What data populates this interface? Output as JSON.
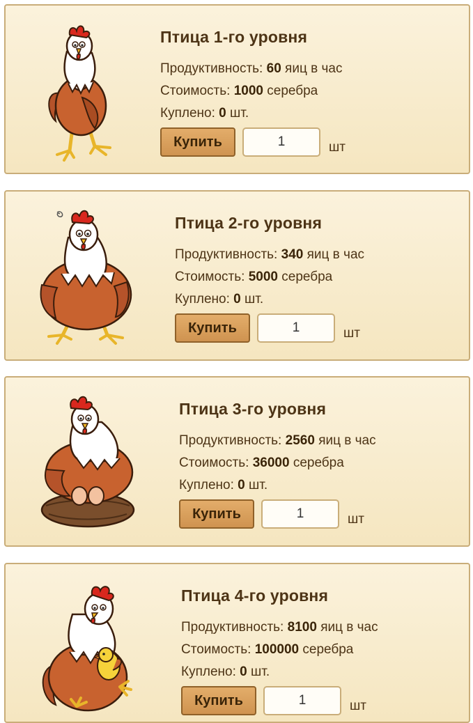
{
  "birds": [
    {
      "title": "Птица 1-го уровня",
      "productivity_label": "Продуктивность:",
      "productivity_value": "60",
      "productivity_unit": "яиц в час",
      "cost_label": "Стоимость:",
      "cost_value": "1000",
      "cost_unit": "серебра",
      "bought_label": "Куплено:",
      "bought_value": "0",
      "bought_unit": "шт.",
      "buy_label": "Купить",
      "quantity": "1",
      "quantity_unit": "шт"
    },
    {
      "title": "Птица 2-го уровня",
      "productivity_label": "Продуктивность:",
      "productivity_value": "340",
      "productivity_unit": "яиц в час",
      "cost_label": "Стоимость:",
      "cost_value": "5000",
      "cost_unit": "серебра",
      "bought_label": "Куплено:",
      "bought_value": "0",
      "bought_unit": "шт.",
      "buy_label": "Купить",
      "quantity": "1",
      "quantity_unit": "шт"
    },
    {
      "title": "Птица 3-го уровня",
      "productivity_label": "Продуктивность:",
      "productivity_value": "2560",
      "productivity_unit": "яиц в час",
      "cost_label": "Стоимость:",
      "cost_value": "36000",
      "cost_unit": "серебра",
      "bought_label": "Куплено:",
      "bought_value": "0",
      "bought_unit": "шт.",
      "buy_label": "Купить",
      "quantity": "1",
      "quantity_unit": "шт"
    },
    {
      "title": "Птица 4-го уровня",
      "productivity_label": "Продуктивность:",
      "productivity_value": "8100",
      "productivity_unit": "яиц в час",
      "cost_label": "Стоимость:",
      "cost_value": "100000",
      "cost_unit": "серебра",
      "bought_label": "Куплено:",
      "bought_value": "0",
      "bought_unit": "шт.",
      "buy_label": "Купить",
      "quantity": "1",
      "quantity_unit": "шт"
    }
  ],
  "colors": {
    "card_bg": "#f8ecd0",
    "card_border": "#c9ad79",
    "button_bg": "#dca061",
    "text": "#4d3416",
    "hen_body": "#c8622f",
    "comb": "#d9281e"
  }
}
